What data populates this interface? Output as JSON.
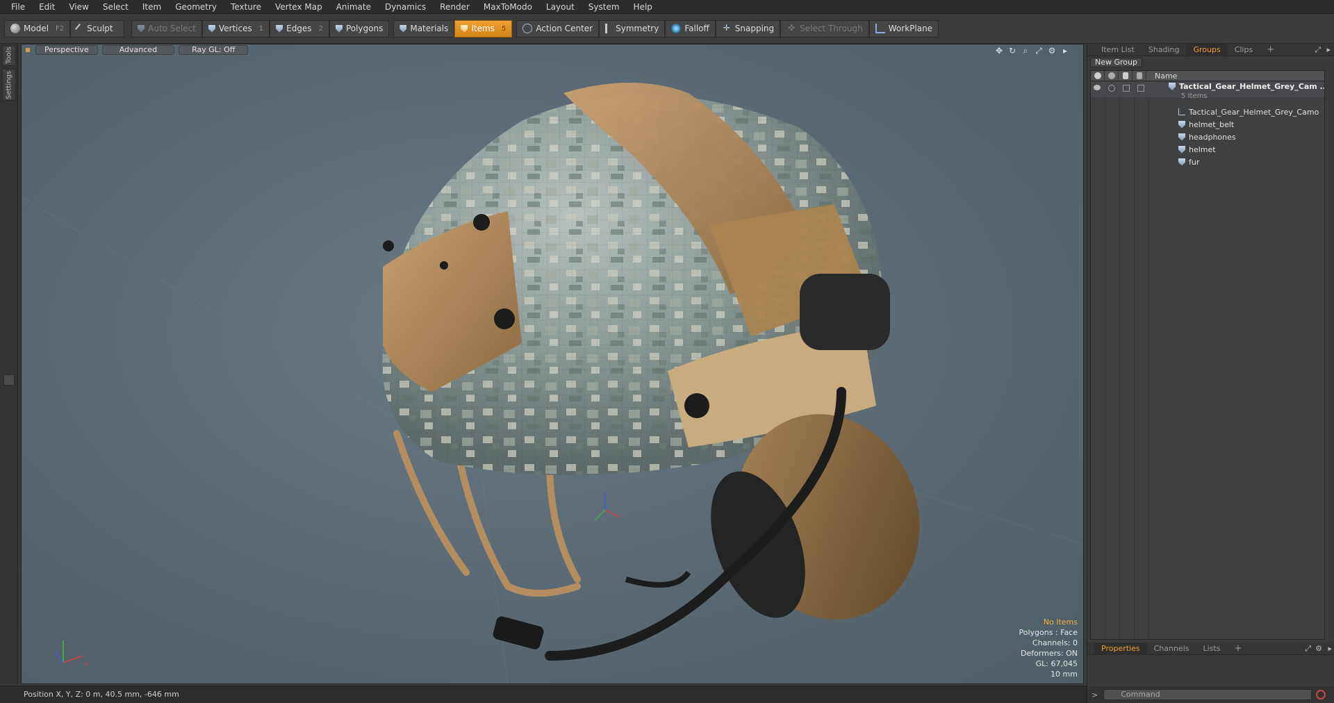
{
  "menu": [
    "File",
    "Edit",
    "View",
    "Select",
    "Item",
    "Geometry",
    "Texture",
    "Vertex Map",
    "Animate",
    "Dynamics",
    "Render",
    "MaxToModo",
    "Layout",
    "System",
    "Help"
  ],
  "toolbar": {
    "model": "Model",
    "model_key": "F2",
    "sculpt": "Sculpt",
    "auto_select": "Auto Select",
    "vertices": "Vertices",
    "vertices_key": "1",
    "edges": "Edges",
    "edges_key": "2",
    "polygons": "Polygons",
    "materials": "Materials",
    "items": "Items",
    "items_key": "5",
    "action_center": "Action Center",
    "symmetry": "Symmetry",
    "falloff": "Falloff",
    "snapping": "Snapping",
    "select_through": "Select Through",
    "workplane": "WorkPlane",
    "active_color": "#e8951f"
  },
  "left_tabs": [
    "Tools",
    "Settings"
  ],
  "viewport": {
    "view_mode": "Perspective",
    "shading": "Advanced",
    "ray_gl": "Ray GL: Off",
    "info": {
      "selection": "No Items",
      "polygons": "Polygons : Face",
      "channels": "Channels: 0",
      "deformers": "Deformers: ON",
      "gl": "GL: 67,045",
      "scale": "10 mm"
    }
  },
  "status": {
    "position": "Position X, Y, Z:  0 m, 40.5 mm, -646 mm"
  },
  "right_panel": {
    "top_tabs": [
      "Item List",
      "Shading",
      "Groups",
      "Clips",
      "+"
    ],
    "active_top_tab": "Groups",
    "new_group": "New Group",
    "name_header": "Name",
    "group": {
      "name": "Tactical_Gear_Helmet_Grey_Cam ...",
      "count": "5 Items"
    },
    "items": [
      "Tactical_Gear_Helmet_Grey_Camo",
      "helmet_belt",
      "headphones",
      "helmet",
      "fur"
    ],
    "bottom_tabs": [
      "Properties",
      "Channels",
      "Lists",
      "+"
    ],
    "active_bottom_tab": "Properties",
    "command_placeholder": "Command"
  }
}
